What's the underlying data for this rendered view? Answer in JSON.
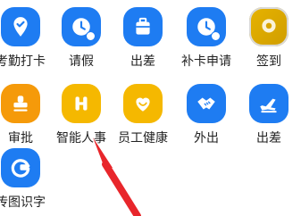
{
  "apps": [
    {
      "label": "考勤打卡",
      "icon": "location-check-icon",
      "color": "#1e7cf2"
    },
    {
      "label": "请假",
      "icon": "clock-person-icon",
      "color": "#1e7cf2"
    },
    {
      "label": "出差",
      "icon": "suitcase-icon",
      "color": "#1e7cf2"
    },
    {
      "label": "补卡申请",
      "icon": "clock-person-icon",
      "color": "#1e7cf2"
    },
    {
      "label": "签到",
      "icon": "location-pin-icon",
      "color": "#e0ac00"
    },
    {
      "label": "审批",
      "icon": "stamp-icon",
      "color": "#f59a0a"
    },
    {
      "label": "智能人事",
      "icon": "h-logo-icon",
      "color": "#f5b800"
    },
    {
      "label": "员工健康",
      "icon": "heart-icon",
      "color": "#f5b800"
    },
    {
      "label": "外出",
      "icon": "handshake-icon",
      "color": "#1e7cf2"
    },
    {
      "label": "出差",
      "icon": "airplane-icon",
      "color": "#1e7cf2"
    },
    {
      "label": "传图识字",
      "icon": "ocr-g-icon",
      "color": "#1e7cf2"
    }
  ],
  "arrow_color": "#e8262b"
}
